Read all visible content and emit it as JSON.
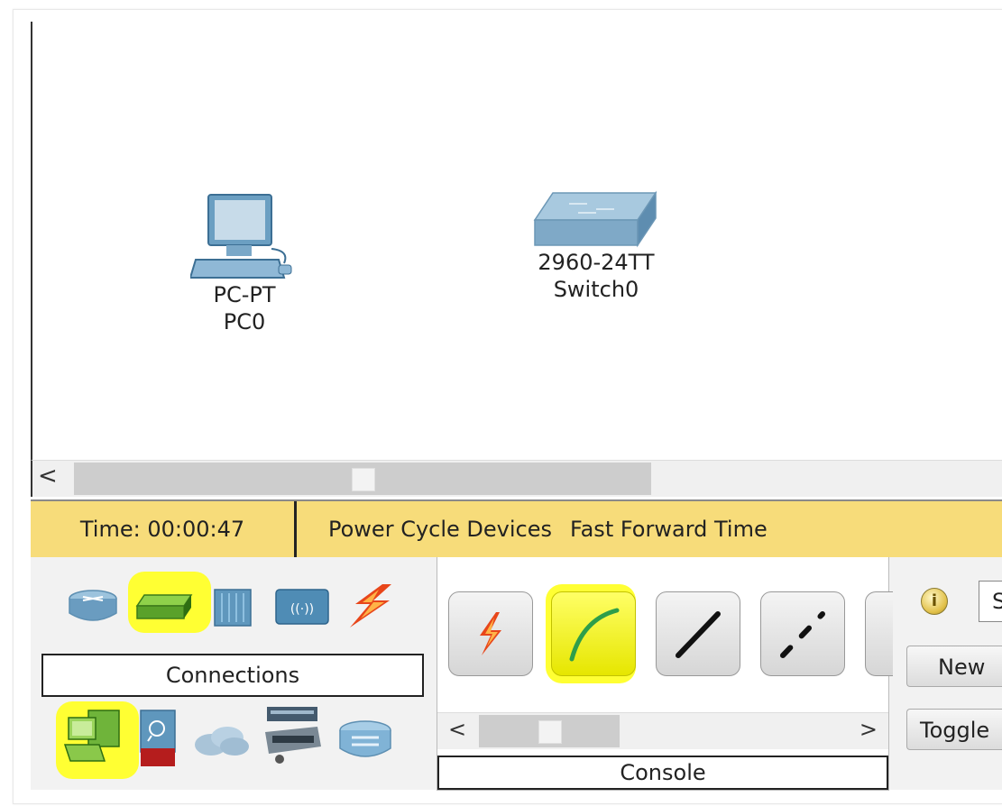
{
  "workspace": {
    "devices": [
      {
        "model": "PC-PT",
        "name": "PC0"
      },
      {
        "model": "2960-24TT",
        "name": "Switch0"
      }
    ]
  },
  "scrollbar": {
    "left_arrow": "<"
  },
  "statusbar": {
    "time_label": "Time: 00:00:47",
    "power_cycle_label": "Power Cycle Devices",
    "fast_forward_label": "Fast Forward Time"
  },
  "device_panel": {
    "category_label": "Connections",
    "top_icons": [
      "router-icon",
      "switch-icon",
      "hub-icon",
      "wireless-icon",
      "connections-icon"
    ],
    "bottom_icons": [
      "end-devices-icon",
      "security-icon",
      "wan-emulation-icon",
      "custom-devices-icon",
      "multiuser-icon"
    ],
    "highlight_color": "#ffff33"
  },
  "connections_panel": {
    "label": "Console",
    "buttons": [
      "automatic-connection-icon",
      "console-cable-icon",
      "straight-through-cable-icon",
      "crossover-cable-icon"
    ],
    "scroll_left": "<",
    "scroll_right": ">"
  },
  "scenario_panel": {
    "info_glyph": "i",
    "scenario_value": "S",
    "new_label": "New",
    "toggle_label": "Toggle"
  }
}
